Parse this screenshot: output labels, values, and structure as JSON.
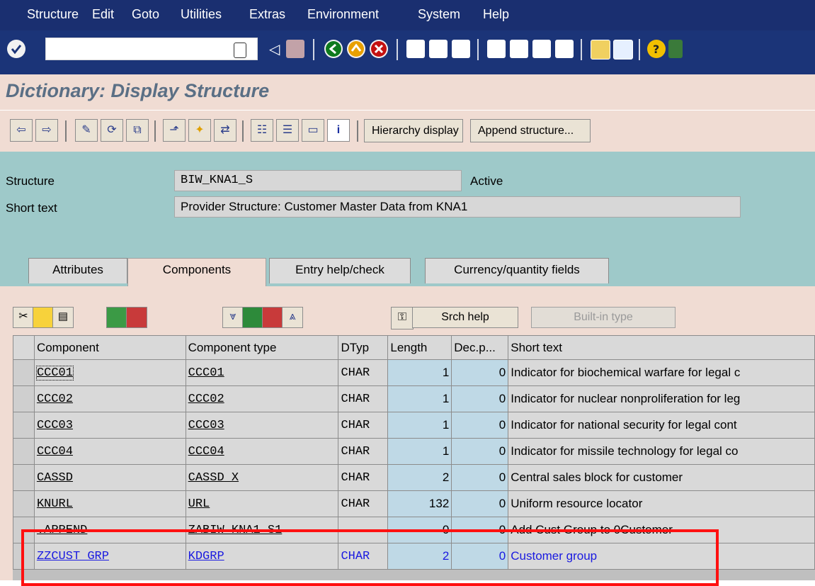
{
  "menu": [
    "Structure",
    "Edit",
    "Goto",
    "Utilities",
    "Extras",
    "Environment",
    "System",
    "Help"
  ],
  "title": "Dictionary: Display Structure",
  "toolbar": {
    "hierarchy_label": "Hierarchy display",
    "append_label": "Append structure..."
  },
  "header": {
    "structure_label": "Structure",
    "structure_value": "BIW_KNA1_S",
    "status": "Active",
    "short_text_label": "Short text",
    "short_text_value": "Provider Structure: Customer Master Data from KNA1"
  },
  "tabs": [
    "Attributes",
    "Components",
    "Entry help/check",
    "Currency/quantity fields"
  ],
  "table_toolbar": {
    "srch_help": "Srch help",
    "builtin_type": "Built-in type"
  },
  "table": {
    "columns": [
      "Component",
      "Component type",
      "DTyp",
      "Length",
      "Dec.p...",
      "Short text"
    ],
    "rows": [
      {
        "component": "CCC01",
        "type": "CCC01",
        "dtyp": "CHAR",
        "length": "1",
        "dec": "0",
        "text": "Indicator for biochemical warfare for legal c"
      },
      {
        "component": "CCC02",
        "type": "CCC02",
        "dtyp": "CHAR",
        "length": "1",
        "dec": "0",
        "text": "Indicator for nuclear nonproliferation for leg"
      },
      {
        "component": "CCC03",
        "type": "CCC03",
        "dtyp": "CHAR",
        "length": "1",
        "dec": "0",
        "text": "Indicator for national security for legal cont"
      },
      {
        "component": "CCC04",
        "type": "CCC04",
        "dtyp": "CHAR",
        "length": "1",
        "dec": "0",
        "text": "Indicator for missile technology for legal co"
      },
      {
        "component": "CASSD",
        "type": "CASSD_X",
        "dtyp": "CHAR",
        "length": "2",
        "dec": "0",
        "text": "Central sales block for customer"
      },
      {
        "component": "KNURL",
        "type": "URL",
        "dtyp": "CHAR",
        "length": "132",
        "dec": "0",
        "text": "Uniform resource locator"
      },
      {
        "component": ".APPEND",
        "type": "ZABIW_KNA1_S1",
        "dtyp": "",
        "length": "0",
        "dec": "0",
        "text": "Add Cust Group to 0Customer"
      },
      {
        "component": "ZZCUST_GRP",
        "type": "KDGRP",
        "dtyp": "CHAR",
        "length": "2",
        "dec": "0",
        "text": "Customer group"
      }
    ]
  },
  "colors": {
    "menubar": "#1a2f70",
    "content_bg": "#f0dcd3",
    "header_bg": "#9ec9c9",
    "highlight_box": "#ff1010",
    "appended_text": "#1a1ae0"
  }
}
